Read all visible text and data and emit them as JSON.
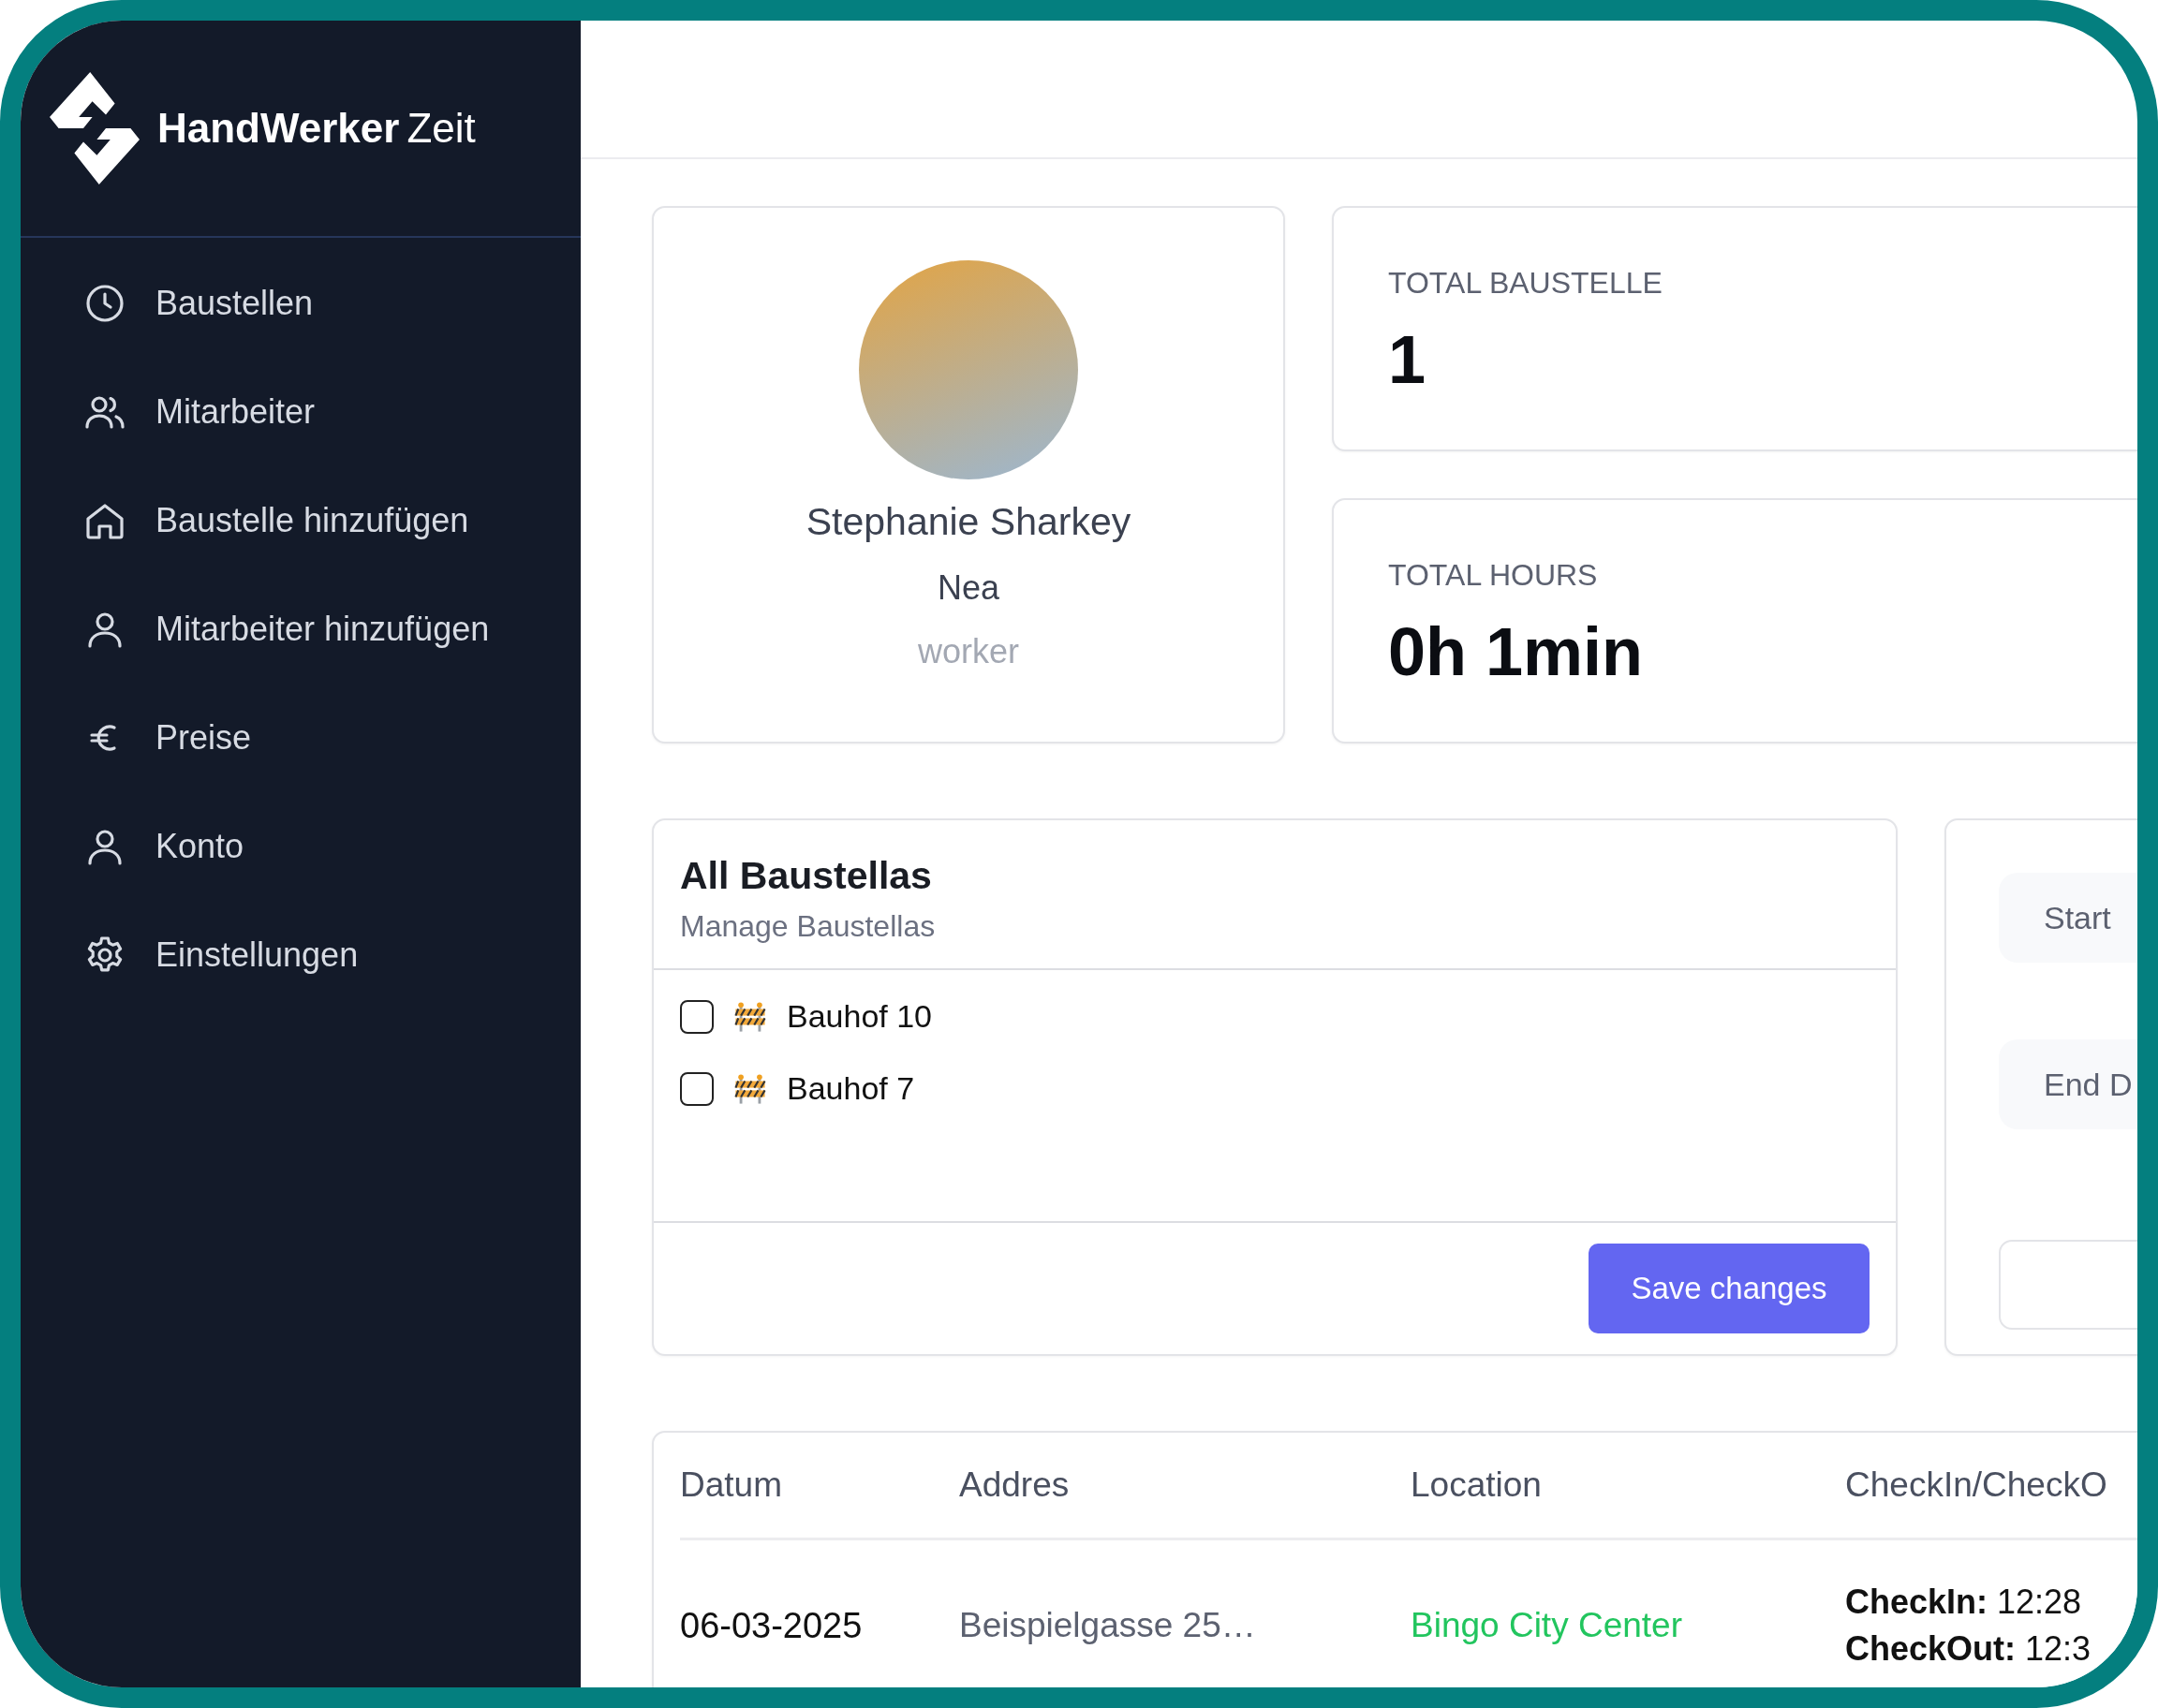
{
  "logo": {
    "primary": "HandWerker",
    "secondary": "Zeit"
  },
  "sidebar": {
    "items": [
      {
        "label": "Baustellen",
        "selected": false
      },
      {
        "label": "Mitarbeiter",
        "selected": false
      },
      {
        "label": "Baustelle hinzufügen",
        "selected": false
      },
      {
        "label": "Mitarbeiter hinzufügen",
        "selected": false
      },
      {
        "label": "Preise",
        "selected": false
      },
      {
        "label": "Konto",
        "selected": false
      },
      {
        "label": "Einstellungen",
        "selected": false
      }
    ]
  },
  "profile": {
    "name": "Stephanie Sharkey",
    "subtitle": "Nea",
    "role": "worker"
  },
  "stats": [
    {
      "label": "TOTAL BAUSTELLE",
      "value": "1"
    },
    {
      "label": "TOTAL HOURS",
      "value": "0h 1min"
    }
  ],
  "baustellas": {
    "title": "All Baustellas",
    "subtitle": "Manage Baustellas",
    "items": [
      {
        "label": "Bauhof 10",
        "checked": false
      },
      {
        "label": "Bauhof 7",
        "checked": false
      }
    ],
    "button": "Save changes"
  },
  "filters": [
    {
      "kind": "date",
      "placeholder": "Start"
    },
    {
      "kind": "date",
      "placeholder": "End D"
    },
    {
      "kind": "plain"
    }
  ],
  "table": {
    "columns": [
      "Datum",
      "Addres",
      "Location",
      "CheckIn/CheckO"
    ],
    "rows": [
      {
        "datum": "06-03-2025",
        "addres": "Beispielgasse 25…",
        "location": "Bingo City Center",
        "checkin": "**CheckIn:** 12:28",
        "checkout": "**CheckOut:** 12:3"
      }
    ]
  }
}
